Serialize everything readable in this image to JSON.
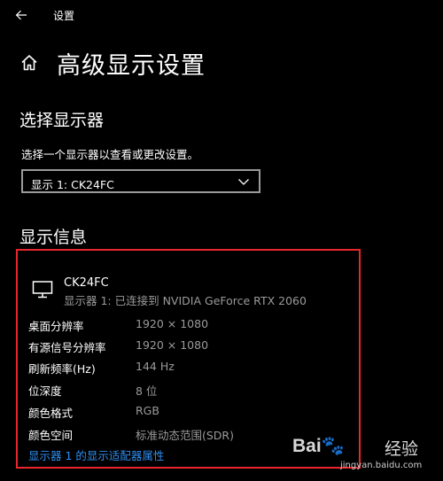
{
  "window": {
    "title": "设置"
  },
  "header": {
    "title": "高级显示设置"
  },
  "select_display": {
    "heading": "选择显示器",
    "help_text": "选择一个显示器以查看或更改设置。",
    "selected": "显示 1: CK24FC"
  },
  "display_info": {
    "heading": "显示信息",
    "monitor_name": "CK24FC",
    "connection": "显示器 1: 已连接到 NVIDIA GeForce RTX 2060",
    "rows": [
      {
        "label": "桌面分辨率",
        "value": "1920 × 1080"
      },
      {
        "label": "有源信号分辨率",
        "value": "1920 × 1080"
      },
      {
        "label": "刷新频率(Hz)",
        "value": "144 Hz"
      },
      {
        "label": "位深度",
        "value": "8 位"
      },
      {
        "label": "颜色格式",
        "value": "RGB"
      },
      {
        "label": "颜色空间",
        "value": "标准动态范围(SDR)"
      }
    ],
    "adapter_link": "显示器 1 的显示适配器属性"
  },
  "watermark": {
    "logo": "Bai🐾",
    "jingyan": "经验",
    "url": "jingyan.baidu.com"
  },
  "colors": {
    "background": "#000000",
    "text": "#ffffff",
    "secondary_text": "#9a9a9a",
    "link": "#2e8ef0",
    "highlight_border": "#e8262b"
  }
}
